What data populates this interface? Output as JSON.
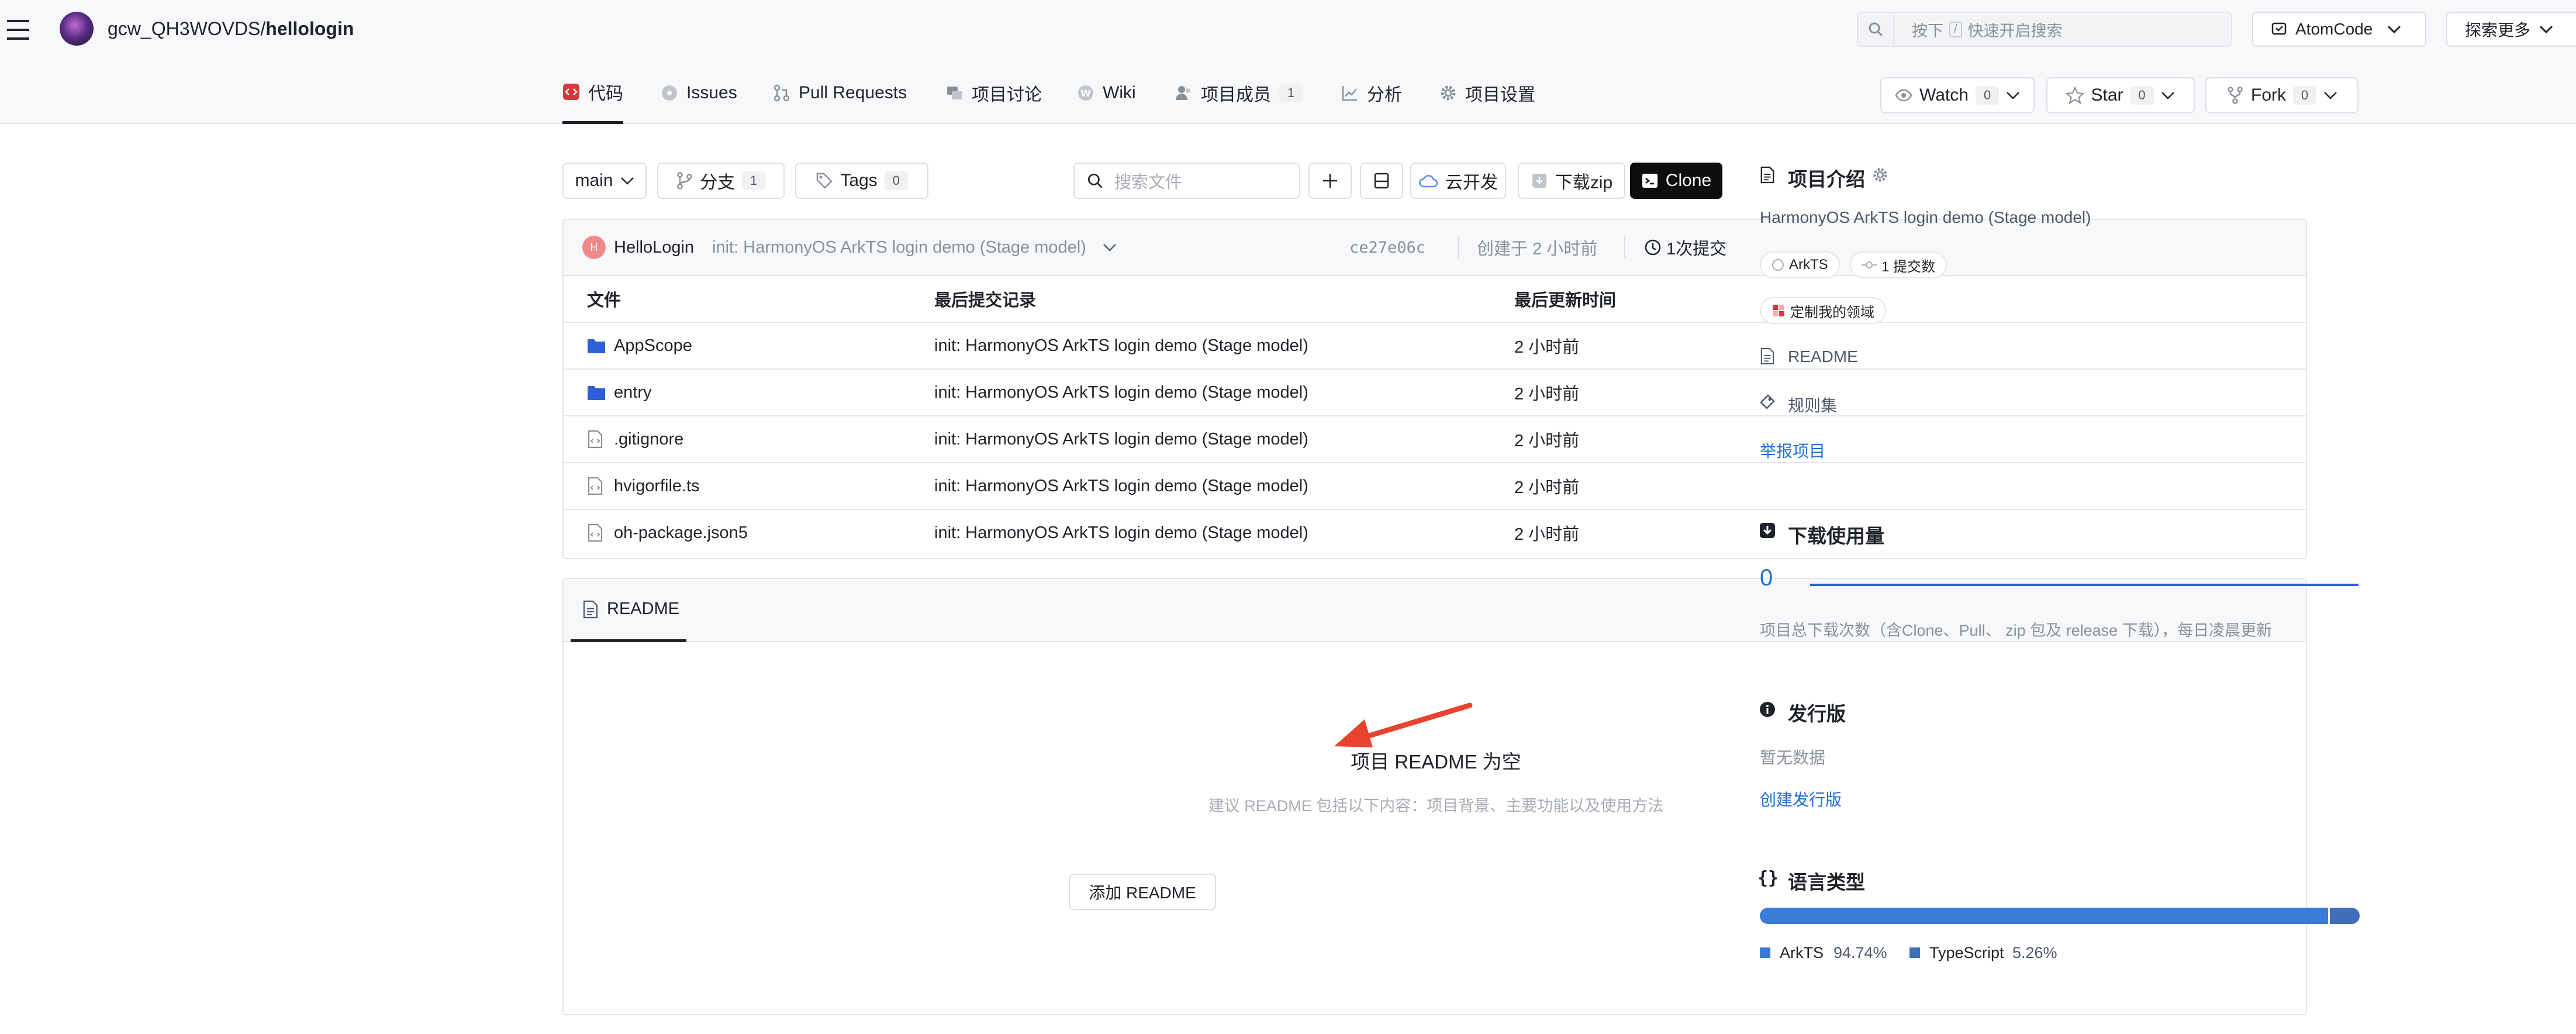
{
  "header": {
    "owner": "gcw_QH3WOVDS/",
    "repo": "hellologin",
    "search_key_prefix": "按下",
    "search_key": "/",
    "search_placeholder": "快速开启搜索",
    "atomcode_label": "AtomCode",
    "explore_label": "探索更多"
  },
  "nav": {
    "tabs": [
      {
        "label": "代码"
      },
      {
        "label": "Issues"
      },
      {
        "label": "Pull Requests"
      },
      {
        "label": "项目讨论"
      },
      {
        "label": "Wiki"
      },
      {
        "label": "项目成员",
        "count": "1"
      },
      {
        "label": "分析"
      },
      {
        "label": "项目设置"
      }
    ],
    "watch_label": "Watch",
    "watch_count": "0",
    "star_label": "Star",
    "star_count": "0",
    "fork_label": "Fork",
    "fork_count": "0"
  },
  "toolbar": {
    "branch": "main",
    "branches_label": "分支",
    "branches_count": "1",
    "tags_label": "Tags",
    "tags_count": "0",
    "search_placeholder": "搜索文件",
    "cloud_label": "云开发",
    "download_label": "下载zip",
    "clone_label": "Clone"
  },
  "commit": {
    "avatar_letter": "H",
    "author": "HelloLogin",
    "message": "init: HarmonyOS ArkTS login demo (Stage model)",
    "hash": "ce27e06c",
    "created": "创建于 2 小时前",
    "commits_label": "1次提交"
  },
  "files": {
    "headers": [
      "文件",
      "最后提交记录",
      "最后更新时间"
    ],
    "rows": [
      {
        "name": "AppScope",
        "type": "folder",
        "message": "init: HarmonyOS ArkTS login demo (Stage model)",
        "time": "2 小时前"
      },
      {
        "name": "entry",
        "type": "folder",
        "message": "init: HarmonyOS ArkTS login demo (Stage model)",
        "time": "2 小时前"
      },
      {
        "name": ".gitignore",
        "type": "file",
        "message": "init: HarmonyOS ArkTS login demo (Stage model)",
        "time": "2 小时前"
      },
      {
        "name": "hvigorfile.ts",
        "type": "file",
        "message": "init: HarmonyOS ArkTS login demo (Stage model)",
        "time": "2 小时前"
      },
      {
        "name": "oh-package.json5",
        "type": "file",
        "message": "init: HarmonyOS ArkTS login demo (Stage model)",
        "time": "2 小时前"
      }
    ]
  },
  "readme": {
    "tab_label": "README",
    "empty_title": "项目 README 为空",
    "empty_hint": "建议 README 包括以下内容：项目背景、主要功能以及使用方法",
    "add_label": "添加 README"
  },
  "sidebar": {
    "intro_title": "项目介绍",
    "description": "HarmonyOS ArkTS login demo (Stage model)",
    "tag_arkts": "ArkTS",
    "tag_commits": "1 提交数",
    "tag_domain": "定制我的领域",
    "readme_link": "README",
    "rules_link": "规则集",
    "report_link": "举报项目",
    "downloads_title": "下载使用量",
    "downloads_count": "0",
    "downloads_note": "项目总下载次数（含Clone、Pull、 zip 包及 release 下载），每日凌晨更新",
    "releases_title": "发行版",
    "releases_empty": "暂无数据",
    "create_release": "创建发行版",
    "languages_title": "语言类型",
    "languages": [
      {
        "name": "ArkTS",
        "percent": "94.74%",
        "share": 94.74,
        "color": "#3a7bd5"
      },
      {
        "name": "TypeScript",
        "percent": "5.26%",
        "share": 5.26,
        "color": "#3e6fb8"
      }
    ]
  },
  "colors": {
    "accent": "#1e6fd9",
    "arrow": "#e8432e",
    "code_tab_icon": "#d9363e"
  }
}
